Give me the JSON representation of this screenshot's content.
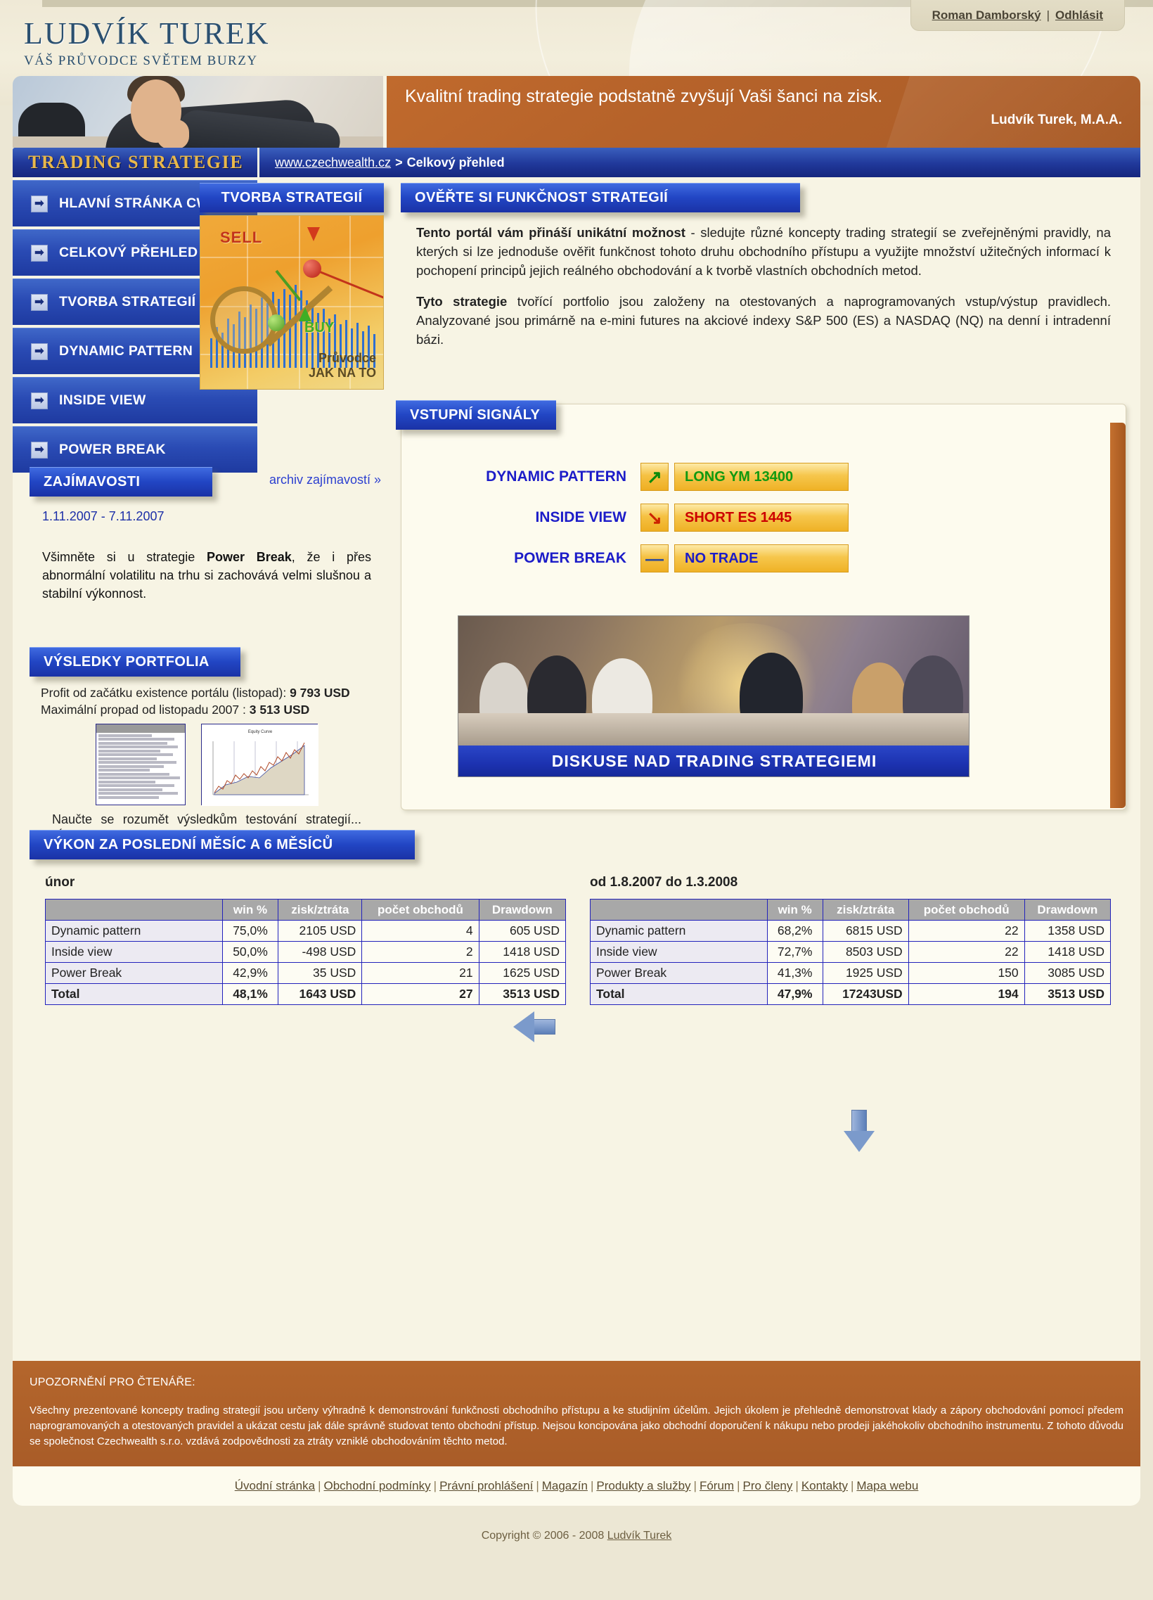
{
  "header": {
    "logo_line1": "LUDVÍK TUREK",
    "logo_line2": "VÁŠ PRŮVODCE SVĚTEM BURZY",
    "user_name": "Roman Damborský",
    "separator": "|",
    "logout": "Odhlásit"
  },
  "hero": {
    "headline": "Kvalitní trading strategie podstatně zvyšují Vaši šanci na zisk.",
    "author": "Ludvík Turek, M.A.A."
  },
  "navbar": {
    "brand": "TRADING STRATEGIE",
    "breadcrumb_link": "www.czechwealth.cz",
    "breadcrumb_sep": ">",
    "breadcrumb_current": "Celkový přehled"
  },
  "sidebar": {
    "items": [
      {
        "label": "HLAVNÍ STRÁNKA CW",
        "icon": "arrow-right-icon"
      },
      {
        "label": "CELKOVÝ PŘEHLED",
        "icon": "arrow-right-icon"
      },
      {
        "label": "TVORBA STRATEGIÍ",
        "icon": "arrow-right-icon"
      },
      {
        "label": "DYNAMIC PATTERN",
        "icon": "arrow-right-icon"
      },
      {
        "label": "INSIDE VIEW",
        "icon": "arrow-right-icon"
      },
      {
        "label": "POWER BREAK",
        "icon": "arrow-right-icon"
      }
    ]
  },
  "tvorba": {
    "title": "TVORBA STRATEGIÍ",
    "img_sell": "SELL",
    "img_buy": "BUY",
    "img_guide1": "Průvodce",
    "img_guide2": "JAK NA TO"
  },
  "overte": {
    "title": "OVĚŘTE SI FUNKČNOST STRATEGIÍ",
    "p1_bold": "Tento portál vám přináší unikátní možnost",
    "p1_rest": " - sledujte různé koncepty trading strategií se zveřejněnými pravidly, na kterých si lze jednoduše ověřit funkčnost tohoto druhu obchodního přístupu a využijte množství užitečných informací k pochopení principů jejich reálného obchodování a k tvorbě vlastních obchodních metod.",
    "p2_bold": "Tyto strategie",
    "p2_rest": " tvořící portfolio jsou založeny na otestovaných a naprogramovaných vstup/výstup pravidlech. Analyzované jsou primárně na e-mini futures na akciové indexy S&P 500 (ES) a NASDAQ (NQ) na denní i intradenní bázi."
  },
  "zajimavosti": {
    "title": "ZAJÍMAVOSTI",
    "archive_link": "archiv zajímavostí »",
    "date_range": "1.11.2007 - 7.11.2007",
    "text_1": "Všimněte si u strategie ",
    "text_bold": "Power Break",
    "text_2": ", že i přes abnormální volatilitu na trhu si zachovává velmi slušnou a stabilní výkonnost."
  },
  "vysledky": {
    "title": "VÝSLEDKY PORTFOLIA",
    "line1_label": "Profit od začátku existence portálu (listopad): ",
    "line1_value": "9 793 USD",
    "line2_label": "Maximální propad od listopadu 2007 : ",
    "line2_value": "3 513 USD",
    "footer_text": "Naučte se rozumět výsledkům testování strategií... více »",
    "mini1_title": "Summary - All Trades",
    "mini2_title": "Equity Curve"
  },
  "signals": {
    "title": "VSTUPNÍ SIGNÁLY",
    "rows": [
      {
        "strategy": "DYNAMIC PATTERN",
        "direction": "up",
        "icon": "arrow-up-right-icon",
        "value": "LONG YM 13400",
        "value_color": "#119911"
      },
      {
        "strategy": "INSIDE VIEW",
        "direction": "down",
        "icon": "arrow-down-right-icon",
        "value": "SHORT ES 1445",
        "value_color": "#cc0000"
      },
      {
        "strategy": "POWER BREAK",
        "direction": "flat",
        "icon": "minus-icon",
        "value": "NO TRADE",
        "value_color": "#1c1cc8"
      }
    ],
    "banner_caption": "DISKUSE NAD TRADING STRATEGIEMI"
  },
  "performance": {
    "title": "VÝKON ZA POSLEDNÍ MĚSÍC A 6 MĚSÍCŮ",
    "columns": [
      "",
      "win %",
      "zisk/ztráta",
      "počet obchodů",
      "Drawdown"
    ],
    "tables": [
      {
        "caption": "únor",
        "rows": [
          {
            "name": "Dynamic pattern",
            "win": "75,0%",
            "pnl": "2105 USD",
            "trades": "4",
            "dd": "605 USD"
          },
          {
            "name": "Inside view",
            "win": "50,0%",
            "pnl": "-498 USD",
            "trades": "2",
            "dd": "1418 USD"
          },
          {
            "name": "Power Break",
            "win": "42,9%",
            "pnl": "35 USD",
            "trades": "21",
            "dd": "1625 USD"
          },
          {
            "name": "Total",
            "win": "48,1%",
            "pnl": "1643 USD",
            "trades": "27",
            "dd": "3513 USD",
            "total": true
          }
        ]
      },
      {
        "caption": "od 1.8.2007 do 1.3.2008",
        "rows": [
          {
            "name": "Dynamic pattern",
            "win": "68,2%",
            "pnl": "6815 USD",
            "trades": "22",
            "dd": "1358 USD"
          },
          {
            "name": "Inside view",
            "win": "72,7%",
            "pnl": "8503 USD",
            "trades": "22",
            "dd": "1418 USD"
          },
          {
            "name": "Power Break",
            "win": "41,3%",
            "pnl": "1925 USD",
            "trades": "150",
            "dd": "3085 USD"
          },
          {
            "name": "Total",
            "win": "47,9%",
            "pnl": "17243USD",
            "trades": "194",
            "dd": "3513 USD",
            "total": true
          }
        ]
      }
    ]
  },
  "disclaimer": {
    "title": "UPOZORNĚNÍ PRO ČTENÁŘE:",
    "body": "Všechny prezentované koncepty trading strategií jsou určeny výhradně k demonstrování funkčnosti obchodního přístupu a ke studijním účelům. Jejich úkolem je přehledně demonstrovat klady a zápory obchodování pomocí předem naprogramovaných a otestovaných pravidel a ukázat cestu jak dále správně studovat tento obchodní přístup. Nejsou koncipována jako obchodní doporučení k nákupu nebo prodeji jakéhokoliv obchodního instrumentu. Z tohoto důvodu se společnost Czechwealth s.r.o. vzdává zodpovědnosti za ztráty vzniklé obchodováním těchto metod."
  },
  "footer": {
    "links": [
      "Úvodní stránka",
      "Obchodní podmínky",
      "Právní prohlášení",
      "Magazín",
      "Produkty a služby",
      "Fórum",
      "Pro členy",
      "Kontakty",
      "Mapa webu"
    ],
    "separator": "|",
    "copyright_prefix": "Copyright © 2006 - 2008 ",
    "copyright_link": "Ludvík Turek"
  },
  "colors": {
    "brand_blue": "#1e3aa0",
    "accent_orange": "#b4662c",
    "page_bg": "#ece7d4",
    "card_bg": "#fdfbee",
    "gold": "#e9b84b"
  }
}
